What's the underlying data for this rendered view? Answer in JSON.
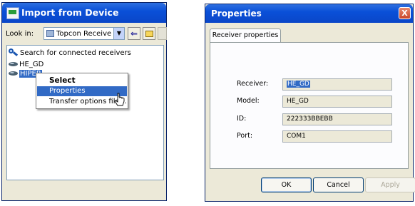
{
  "import_window": {
    "title": "Import from Device",
    "lookin_label": "Look in:",
    "lookin_value": "Topcon Receive",
    "items": [
      {
        "label": "Search for connected receivers",
        "icon": "search-icon"
      },
      {
        "label": "HE_GD",
        "icon": "receiver-icon"
      },
      {
        "label": "HIPER",
        "icon": "receiver-icon",
        "selected": true
      }
    ],
    "context_menu": {
      "items": [
        {
          "label": "Select",
          "bold": true
        },
        {
          "label": "Properties",
          "highlighted": true
        },
        {
          "label": "Transfer options file..."
        }
      ]
    }
  },
  "properties_window": {
    "title": "Properties",
    "close_glyph": "X",
    "tab_label": "Receiver properties",
    "fields": [
      {
        "label": "Receiver:",
        "value": "HE_GD"
      },
      {
        "label": "Model:",
        "value": "HE_GD"
      },
      {
        "label": "ID:",
        "value": "222333BBEBB"
      },
      {
        "label": "Port:",
        "value": "COM1"
      }
    ],
    "buttons": {
      "ok": "OK",
      "cancel": "Cancel",
      "apply": "Apply"
    }
  },
  "colors": {
    "title_bar": "#0a50d8",
    "selection": "#316ac5",
    "window_bg": "#ece9d8"
  }
}
